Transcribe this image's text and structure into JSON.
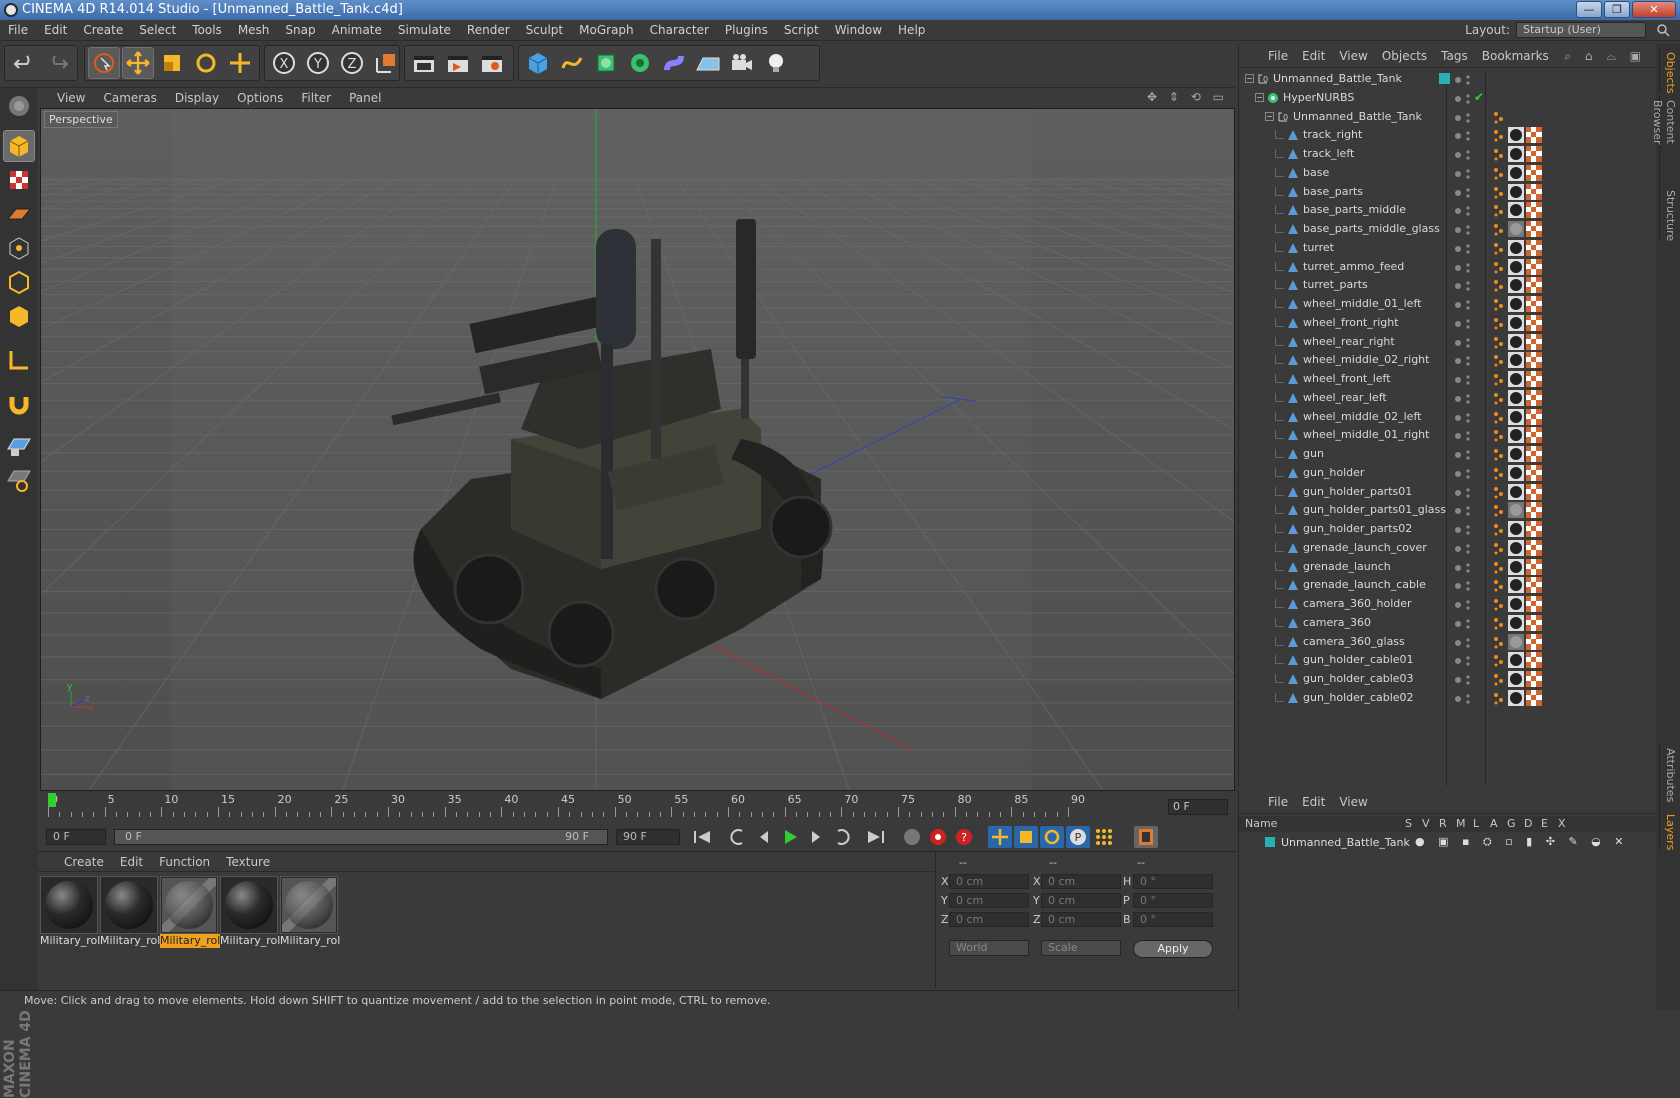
{
  "window": {
    "title": "CINEMA 4D R14.014 Studio - [Unmanned_Battle_Tank.c4d]",
    "min": "—",
    "max": "❐",
    "close": "✕"
  },
  "menu": [
    "File",
    "Edit",
    "Create",
    "Select",
    "Tools",
    "Mesh",
    "Snap",
    "Animate",
    "Simulate",
    "Render",
    "Sculpt",
    "MoGraph",
    "Character",
    "Plugins",
    "Script",
    "Window",
    "Help"
  ],
  "layout": {
    "label": "Layout:",
    "value": "Startup (User)"
  },
  "viewport": {
    "menu": [
      "View",
      "Cameras",
      "Display",
      "Options",
      "Filter",
      "Panel"
    ],
    "label": "Perspective"
  },
  "timeline": {
    "ticks": [
      "0",
      "5",
      "10",
      "15",
      "20",
      "25",
      "30",
      "35",
      "40",
      "45",
      "50",
      "55",
      "60",
      "65",
      "70",
      "75",
      "80",
      "85",
      "90"
    ],
    "current": "0 F"
  },
  "playbar": {
    "start": "0 F",
    "range_start": "0 F",
    "range_end": "90 F",
    "end": "90 F"
  },
  "materials": {
    "menu": [
      "Create",
      "Edit",
      "Function",
      "Texture"
    ],
    "items": [
      {
        "label": "Military_rol",
        "selected": false
      },
      {
        "label": "Military_rol",
        "selected": false
      },
      {
        "label": "Military_rol",
        "selected": true
      },
      {
        "label": "Military_rol",
        "selected": false
      },
      {
        "label": "Military_rol",
        "selected": false
      }
    ]
  },
  "coords": {
    "headers": [
      "--",
      "--",
      "--"
    ],
    "rows": [
      {
        "a": "X",
        "av": "0 cm",
        "b": "X",
        "bv": "0 cm",
        "c": "H",
        "cv": "0 °"
      },
      {
        "a": "Y",
        "av": "0 cm",
        "b": "Y",
        "bv": "0 cm",
        "c": "P",
        "cv": "0 °"
      },
      {
        "a": "Z",
        "av": "0 cm",
        "b": "Z",
        "bv": "0 cm",
        "c": "B",
        "cv": "0 °"
      }
    ],
    "space": "World",
    "mode": "Scale",
    "apply": "Apply"
  },
  "status": "Move: Click and drag to move elements. Hold down SHIFT to quantize movement / add to the selection in point mode, CTRL to remove.",
  "objects": {
    "menu": [
      "File",
      "Edit",
      "View",
      "Objects",
      "Tags",
      "Bookmarks"
    ],
    "root": "Unmanned_Battle_Tank",
    "nurbs": "HyperNURBS",
    "group": "Unmanned_Battle_Tank",
    "items": [
      "track_right",
      "track_left",
      "base",
      "base_parts",
      "base_parts_middle",
      "base_parts_middle_glass",
      "turret",
      "turret_ammo_feed",
      "turret_parts",
      "wheel_middle_01_left",
      "wheel_front_right",
      "wheel_rear_right",
      "wheel_middle_02_right",
      "wheel_front_left",
      "wheel_rear_left",
      "wheel_middle_02_left",
      "wheel_middle_01_right",
      "gun",
      "gun_holder",
      "gun_holder_parts01",
      "gun_holder_parts01_glass",
      "gun_holder_parts02",
      "grenade_launch_cover",
      "grenade_launch",
      "grenade_launch_cable",
      "camera_360_holder",
      "camera_360",
      "camera_360_glass",
      "gun_holder_cable01",
      "gun_holder_cable03",
      "gun_holder_cable02"
    ]
  },
  "layers": {
    "menu": [
      "File",
      "Edit",
      "View"
    ],
    "columns": [
      "Name",
      "S",
      "V",
      "R",
      "M",
      "L",
      "A",
      "G",
      "D",
      "E",
      "X"
    ],
    "row": "Unmanned_Battle_Tank"
  },
  "sidetabs": [
    "Objects",
    "Content Browser",
    "Structure",
    "Attributes",
    "Layers"
  ],
  "brand": "MAXON CINEMA 4D",
  "colors": {
    "accent": "#f0a020",
    "title_bar": "#4a7ab8",
    "panel": "#3a3a3a"
  }
}
